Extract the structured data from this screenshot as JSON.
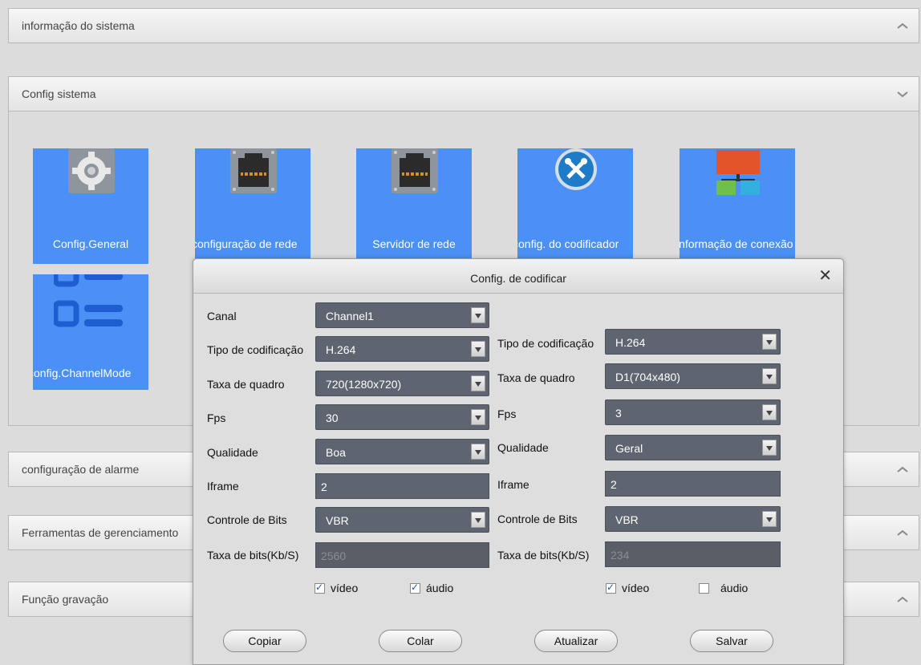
{
  "sections": {
    "info": {
      "label": "informação do sistema"
    },
    "config": {
      "label": "Config sistema"
    },
    "alarm": {
      "label": "configuração de alarme"
    },
    "tools": {
      "label": "Ferramentas de gerenciamento"
    },
    "record": {
      "label": "Função gravação"
    }
  },
  "tiles": [
    {
      "label": "Config.General",
      "icon": "gear-icon"
    },
    {
      "label": "configuração de rede",
      "icon": "network-port-icon"
    },
    {
      "label": "Servidor de rede",
      "icon": "network-port-icon"
    },
    {
      "label": "config. do codificador",
      "icon": "wrench-screwdriver-icon"
    },
    {
      "label": "informação de conexão",
      "icon": "network-diagram-icon"
    },
    {
      "label": "config.ChannelMode",
      "icon": "channel-list-icon"
    }
  ],
  "dialog": {
    "title": "Config. de codificar",
    "channel": {
      "label": "Canal",
      "value": "Channel1"
    },
    "left": {
      "codec_type": {
        "label": "Tipo de codificação",
        "value": "H.264"
      },
      "resolution": {
        "label": "Taxa de quadro",
        "value": "720(1280x720)"
      },
      "fps": {
        "label": "Fps",
        "value": "30"
      },
      "quality": {
        "label": "Qualidade",
        "value": "Boa"
      },
      "iframe": {
        "label": "Iframe",
        "value": "2"
      },
      "bit_control": {
        "label": "Controle de Bits",
        "value": "VBR"
      },
      "bitrate": {
        "label": "Taxa de bits(Kb/S)",
        "value": "2560"
      },
      "video": {
        "label": "vídeo",
        "checked": true
      },
      "audio": {
        "label": "áudio",
        "checked": true
      }
    },
    "right": {
      "codec_type": {
        "label": "Tipo de codificação",
        "value": "H.264"
      },
      "resolution": {
        "label": "Taxa de quadro",
        "value": "D1(704x480)"
      },
      "fps": {
        "label": "Fps",
        "value": "3"
      },
      "quality": {
        "label": "Qualidade",
        "value": "Geral"
      },
      "iframe": {
        "label": "Iframe",
        "value": "2"
      },
      "bit_control": {
        "label": "Controle de Bits",
        "value": "VBR"
      },
      "bitrate": {
        "label": "Taxa de bits(Kb/S)",
        "value": "234"
      },
      "video": {
        "label": "vídeo",
        "checked": true
      },
      "audio": {
        "label": "áudio",
        "checked": false
      }
    },
    "buttons": {
      "copy": "Copiar",
      "paste": "Colar",
      "refresh": "Atualizar",
      "save": "Salvar"
    },
    "close_glyph": "✕"
  },
  "colors": {
    "tile_blue": "#4a90f5",
    "field_bg": "#5e6470",
    "page_bg": "#dcdcdc"
  }
}
